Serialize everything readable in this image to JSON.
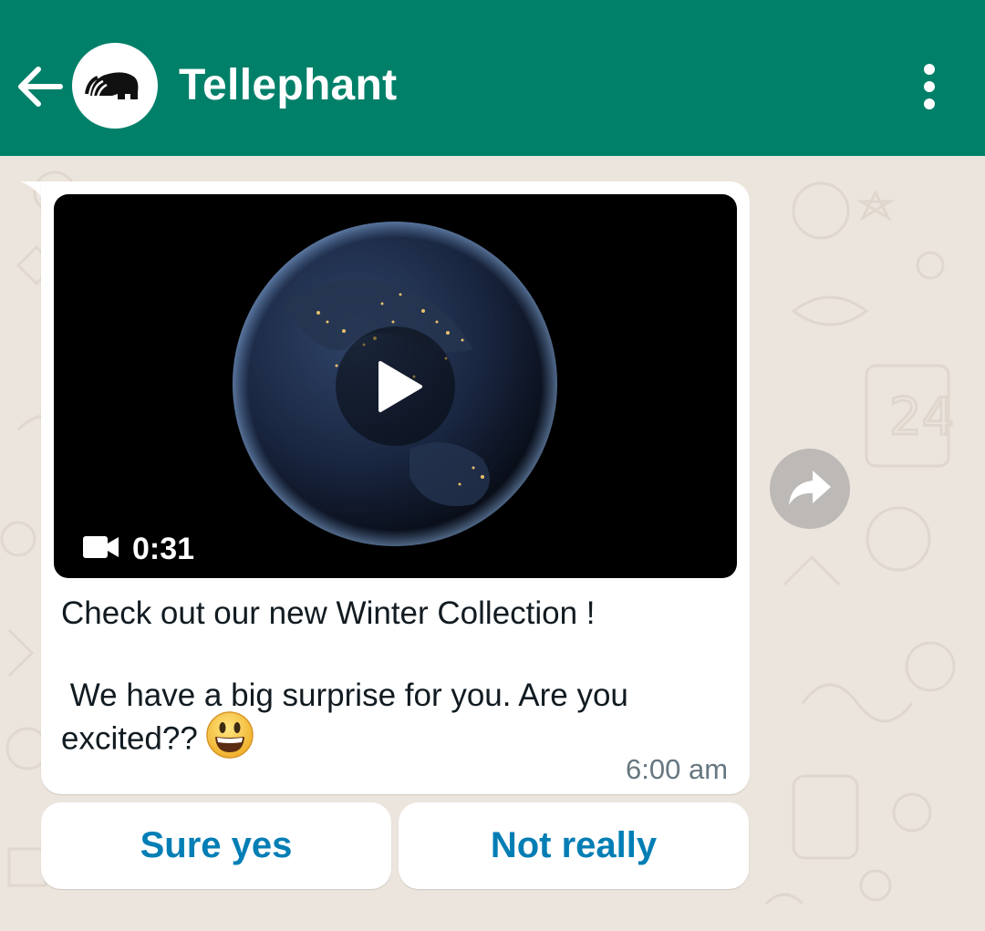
{
  "header": {
    "back_icon": "arrow-left-icon",
    "avatar_icon": "elephant-logo",
    "title": "Tellephant",
    "menu_icon": "more-vertical-icon"
  },
  "message": {
    "video": {
      "type_icon": "video-camera-icon",
      "play_icon": "play-icon",
      "duration": "0:31"
    },
    "text_line_1": "Check out our new Winter Collection !",
    "text_line_2": " We have a big surprise for you. Are you",
    "text_line_3": "excited??",
    "emoji": "grinning-face-emoji",
    "time": "6:00 am"
  },
  "forward_icon": "forward-share-icon",
  "quick_replies": [
    {
      "label": "Sure yes"
    },
    {
      "label": "Not really"
    }
  ],
  "colors": {
    "header_bg": "#008069",
    "wallpaper_bg": "#ece5dd",
    "reply_text": "#027eb5",
    "time_text": "#667781"
  }
}
